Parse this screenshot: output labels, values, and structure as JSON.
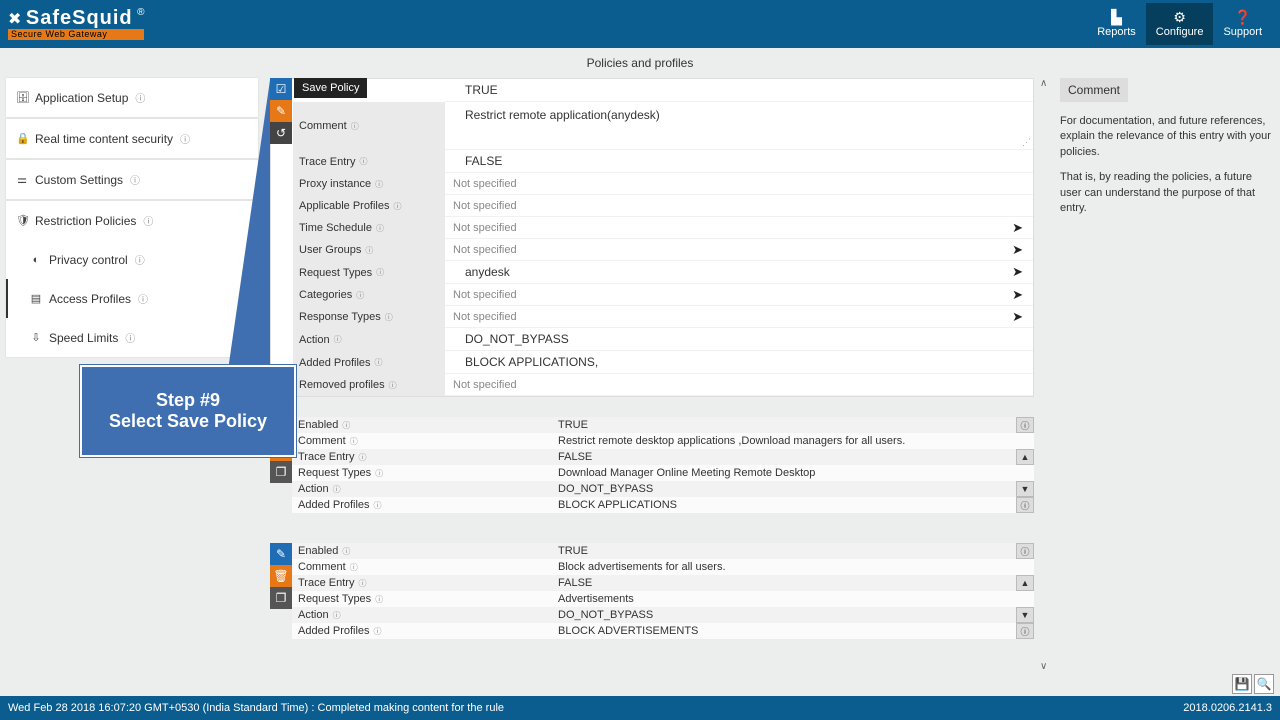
{
  "header": {
    "logo": "SafeSquid",
    "logo_r": "®",
    "logo_sub": "Secure Web Gateway",
    "nav": {
      "reports": "Reports",
      "configure": "Configure",
      "support": "Support"
    }
  },
  "page_title": "Policies and profiles",
  "sidebar": {
    "app_setup": "Application Setup",
    "realtime": "Real time content security",
    "custom": "Custom Settings",
    "restriction": "Restriction Policies",
    "privacy": "Privacy control",
    "access": "Access Profiles",
    "speed": "Speed Limits"
  },
  "save_tooltip": "Save Policy",
  "form": {
    "enabled_val": "TRUE",
    "comment_lbl": "Comment",
    "comment_val": "Restrict remote application(anydesk)",
    "trace_lbl": "Trace Entry",
    "trace_val": "FALSE",
    "proxy_lbl": "Proxy instance",
    "applicable_lbl": "Applicable Profiles",
    "time_lbl": "Time Schedule",
    "user_lbl": "User Groups",
    "reqtypes_lbl": "Request Types",
    "reqtypes_val": "anydesk",
    "categories_lbl": "Categories",
    "resptypes_lbl": "Response Types",
    "action_lbl": "Action",
    "action_val": "DO_NOT_BYPASS",
    "added_lbl": "Added Profiles",
    "added_val": "BLOCK APPLICATIONS,",
    "removed_lbl": "Removed profiles",
    "not_specified": "Not specified"
  },
  "summary1": {
    "enabled_lbl": "Enabled",
    "enabled": "TRUE",
    "comment_lbl": "Comment",
    "comment": "Restrict remote desktop applications ,Download managers for all users.",
    "trace_lbl": "Trace Entry",
    "trace": "FALSE",
    "req_lbl": "Request Types",
    "req": "Download Manager  Online Meeting  Remote Desktop",
    "action_lbl": "Action",
    "action": "DO_NOT_BYPASS",
    "added_lbl": "Added Profiles",
    "added": "BLOCK APPLICATIONS"
  },
  "summary2": {
    "enabled_lbl": "Enabled",
    "enabled": "TRUE",
    "comment_lbl": "Comment",
    "comment": "Block advertisements for all users.",
    "trace_lbl": "Trace Entry",
    "trace": "FALSE",
    "req_lbl": "Request Types",
    "req": "Advertisements",
    "action_lbl": "Action",
    "action": "DO_NOT_BYPASS",
    "added_lbl": "Added Profiles",
    "added": "BLOCK ADVERTISEMENTS"
  },
  "right": {
    "title": "Comment",
    "p1": "For documentation, and future references, explain the relevance of this entry with your policies.",
    "p2": "That is, by reading the policies, a future user can understand the purpose of that entry."
  },
  "callout": {
    "l1": "Step #9",
    "l2": "Select Save Policy"
  },
  "footer": {
    "left": "Wed Feb 28 2018 16:07:20 GMT+0530 (India Standard Time) : Completed making content for the rule",
    "right": "2018.0206.2141.3"
  }
}
